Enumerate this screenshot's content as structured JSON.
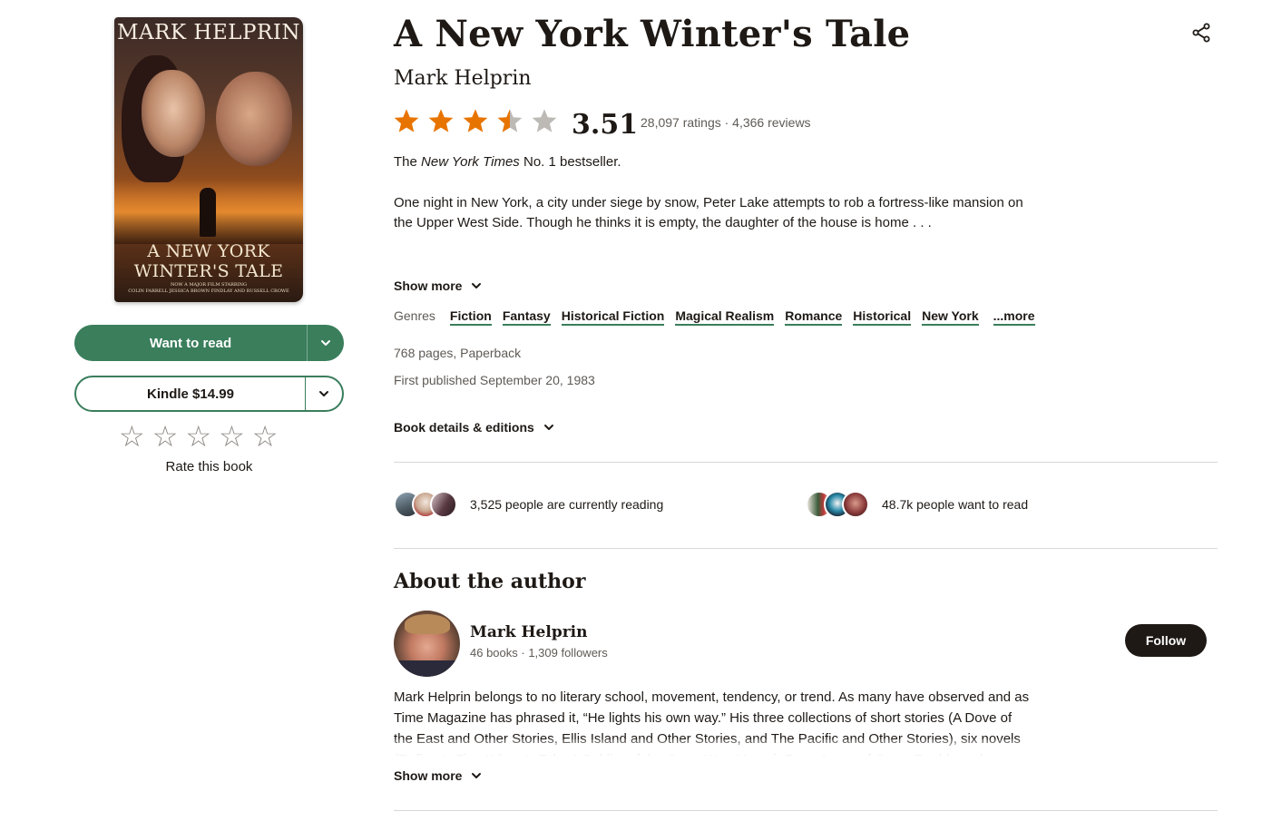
{
  "cover": {
    "author": "MARK HELPRIN",
    "title_line1": "A NEW YORK",
    "title_line2": "WINTER'S TALE",
    "small_line1": "NOW A MAJOR FILM STARRING",
    "small_line2": "COLIN FARRELL JESSICA BROWN FINDLAY AND RUSSELL CROWE"
  },
  "actions": {
    "want_to_read": "Want to read",
    "kindle": "Kindle $14.99",
    "rate_label": "Rate this book",
    "rate_star_glyph": "☆"
  },
  "book": {
    "title": "A New York Winter's Tale",
    "author": "Mark Helprin",
    "average_rating": "3.51",
    "rating_value": 3.51,
    "ratings_text": "28,097 ratings · 4,366 reviews",
    "tagline_pre": "The ",
    "tagline_em": "New York Times",
    "tagline_post": " No. 1 bestseller.",
    "description": "One night in New York, a city under siege by snow, Peter Lake attempts to rob a fortress-like mansion on the Upper West Side. Though he thinks it is empty, the daughter of the house is home . . .",
    "show_more": "Show more",
    "genres_label": "Genres",
    "genres": [
      "Fiction",
      "Fantasy",
      "Historical Fiction",
      "Magical Realism",
      "Romance",
      "Historical",
      "New York"
    ],
    "genres_more": "...more",
    "pages": "768 pages, Paperback",
    "published": "First published September 20, 1983",
    "details_label": "Book details & editions"
  },
  "readers": {
    "currently_reading": "3,525 people are currently reading",
    "want_to_read": "48.7k people want to read"
  },
  "about": {
    "heading": "About the author",
    "name": "Mark Helprin",
    "meta": "46 books · 1,309 followers",
    "follow": "Follow",
    "bio": "Mark Helprin belongs to no literary school, movement, tendency, or trend. As many have observed and as Time Magazine has phrased it, “He lights his own way.” His three collections of short stories (A Dove of the East and Other Stories, Ellis Island and Other Stories, and The Pacific and Other Stories), six novels (Refiner's Fire, Winter's Tale, A Soldier of the Great War, Memoir From Antproof Case, Freddy and Fredericka, In Sunlight and in Shadow)",
    "show_more": "Show more"
  },
  "colors": {
    "brand_green": "#3a7e5c",
    "star_orange": "#e87400",
    "star_gray": "#bdbab6",
    "text": "#1e1915",
    "muted": "#5f5a55"
  }
}
